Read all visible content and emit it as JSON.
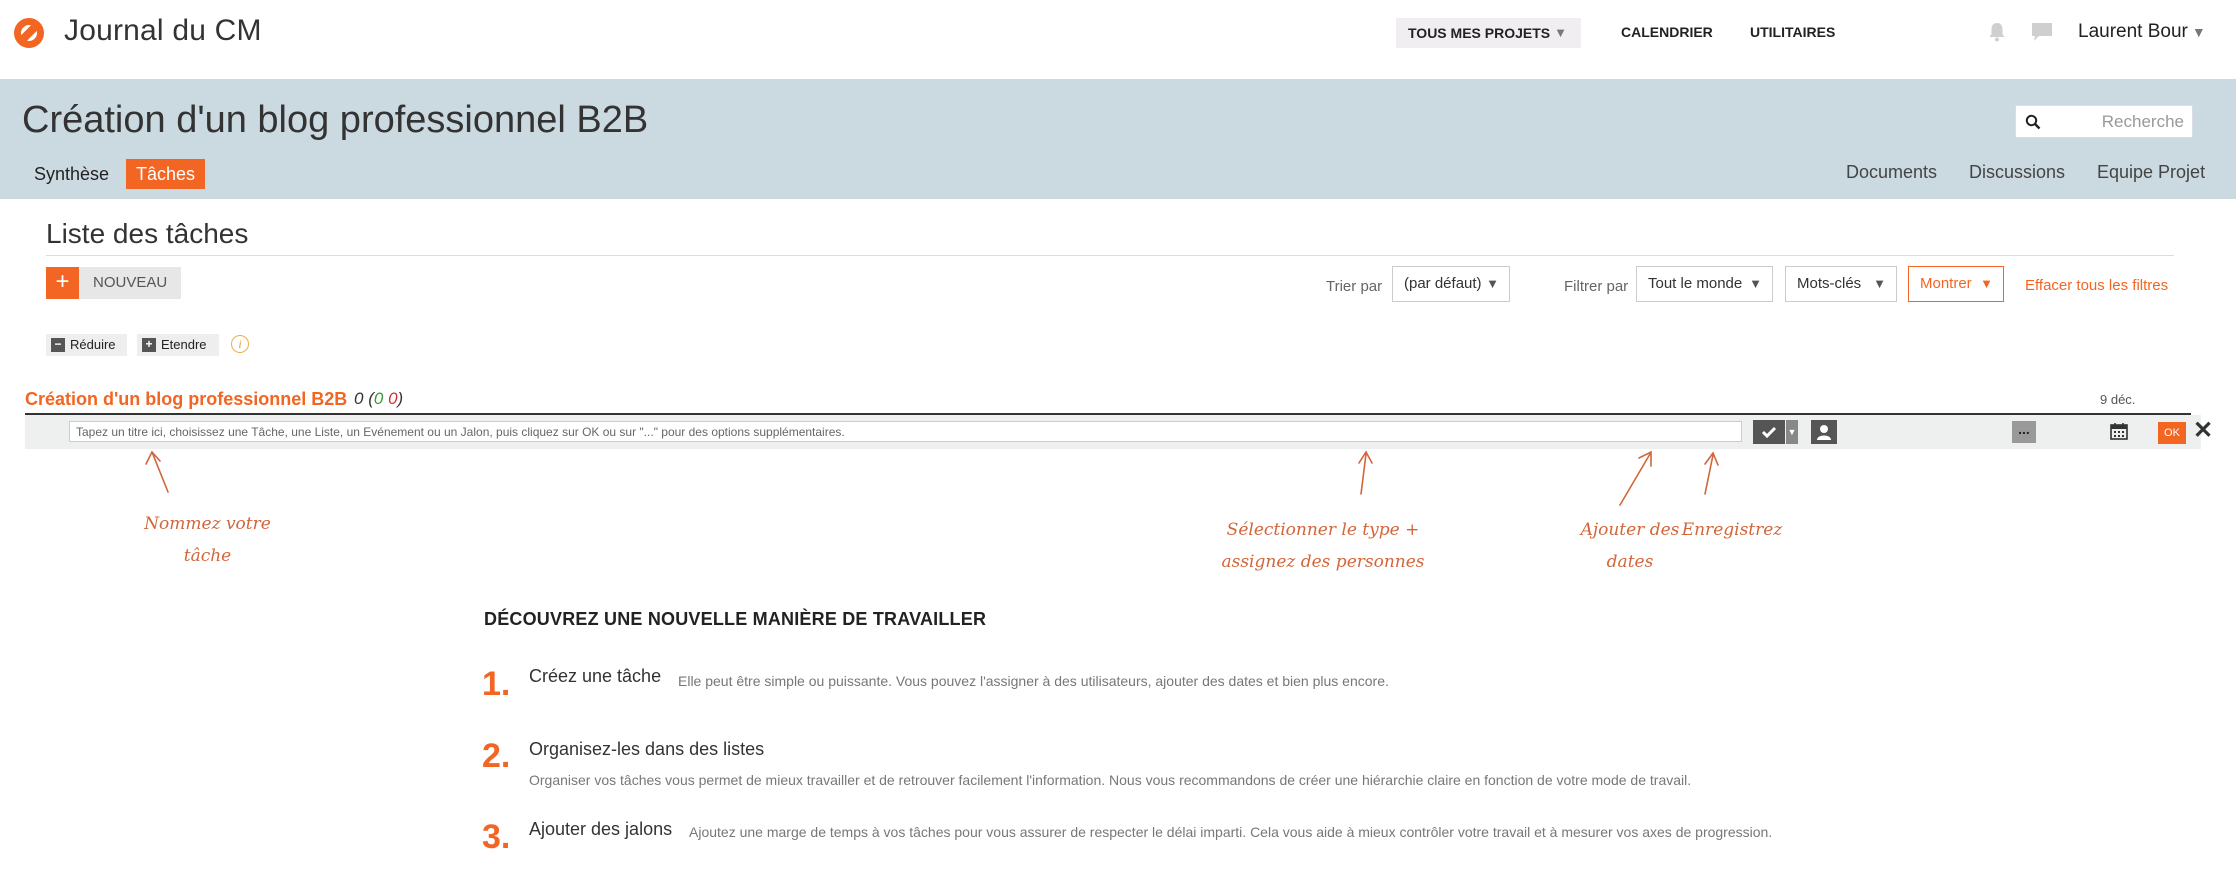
{
  "header": {
    "app_title": "Journal du CM",
    "nav": {
      "projects": "TOUS MES PROJETS",
      "calendar": "CALENDRIER",
      "utilities": "UTILITAIRES"
    },
    "user_name": "Laurent Bour"
  },
  "project": {
    "title": "Création d'un blog professionnel B2B",
    "search_placeholder": "Recherche",
    "tabs": [
      "Synthèse",
      "Tâches"
    ],
    "right_tabs": [
      "Documents",
      "Discussions",
      "Equipe Projet"
    ]
  },
  "tasks": {
    "section_title": "Liste des tâches",
    "new_label": "NOUVEAU",
    "sort_label": "Trier par",
    "sort_value": "(par défaut)",
    "filter_label": "Filtrer par",
    "filter_people": "Tout le monde",
    "filter_keywords": "Mots-clés",
    "filter_show": "Montrer",
    "clear_filters": "Effacer tous les filtres",
    "collapse_label": "Réduire",
    "expand_label": "Etendre"
  },
  "group": {
    "title": "Création d'un blog professionnel B2B",
    "count_total": "0",
    "count_done": "0",
    "count_late": "0",
    "date": "9 déc.",
    "input_placeholder": "Tapez un titre ici, choisissez une Tâche, une Liste, un Evénement ou un Jalon, puis cliquez sur OK ou sur \"...\" pour des options supplémentaires.",
    "more_label": "...",
    "ok_label": "OK",
    "close_label": "✕"
  },
  "annotations": {
    "name_task": "Nommez votre tâche",
    "select_type": "Sélectionner le type + assignez des personnes",
    "add_dates": "Ajouter des dates",
    "save": "Enregistrez"
  },
  "discover": {
    "title": "DÉCOUVREZ UNE NOUVELLE MANIÈRE DE TRAVAILLER",
    "steps": [
      {
        "num": "1.",
        "title": "Créez une tâche",
        "desc": "Elle peut être simple ou puissante. Vous pouvez l'assigner à des utilisateurs, ajouter des dates et bien plus encore."
      },
      {
        "num": "2.",
        "title": "Organisez-les dans des listes",
        "desc": "Organiser vos tâches vous permet de mieux travailler et de retrouver facilement l'information. Nous vous recommandons de créer une hiérarchie claire en fonction de votre mode de travail."
      },
      {
        "num": "3.",
        "title": "Ajouter des jalons",
        "desc": "Ajoutez une marge de temps à vos tâches pour vous assurer de respecter le délai imparti. Cela vous aide à mieux contrôler votre travail et à mesurer vos axes de progression."
      }
    ]
  },
  "colors": {
    "accent": "#f26522",
    "header_band": "#cbd9e1",
    "annotation": "#d2663a"
  }
}
